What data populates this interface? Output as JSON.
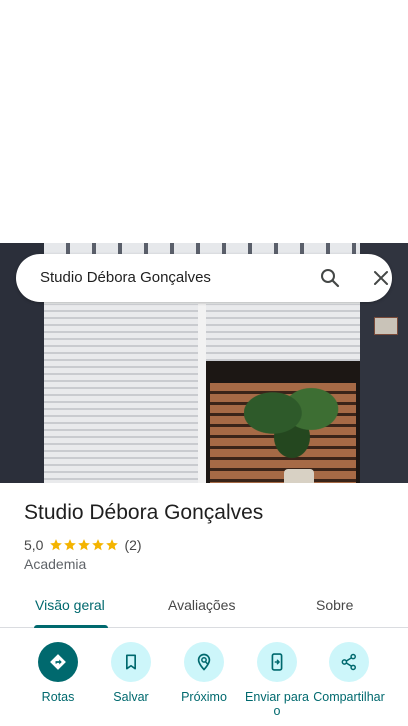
{
  "search": {
    "query": "Studio Débora Gonçalves"
  },
  "place": {
    "name": "Studio Débora Gonçalves",
    "rating": "5,0",
    "review_count": "(2)",
    "category": "Academia"
  },
  "tabs": [
    {
      "label": "Visão geral",
      "active": true
    },
    {
      "label": "Avaliações",
      "active": false
    },
    {
      "label": "Sobre",
      "active": false
    }
  ],
  "actions": [
    {
      "label": "Rotas",
      "icon": "directions-icon"
    },
    {
      "label": "Salvar",
      "icon": "bookmark-icon"
    },
    {
      "label": "Próximo",
      "icon": "nearby-icon"
    },
    {
      "label": "Enviar para o",
      "icon": "send-to-phone-icon"
    },
    {
      "label": "Compartilhar",
      "icon": "share-icon"
    }
  ],
  "colors": {
    "accent": "#00696e",
    "action_bg": "#cdf6fa",
    "star": "#f4b400"
  }
}
